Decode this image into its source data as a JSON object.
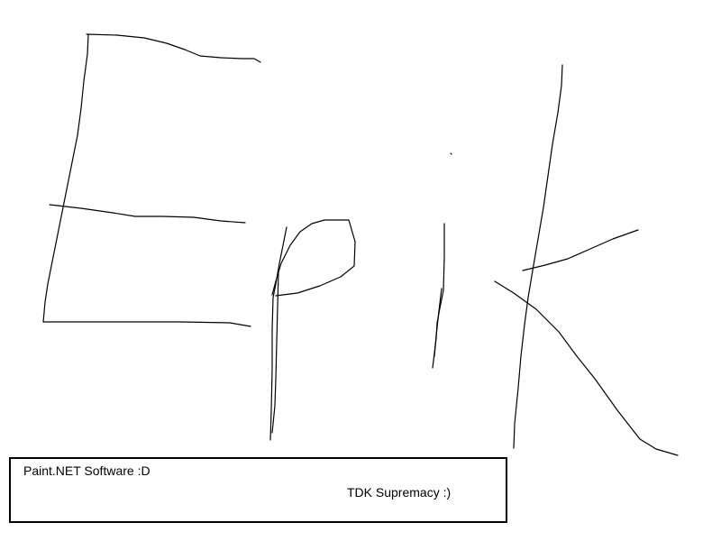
{
  "canvas": {
    "background": "#ffffff",
    "stroke_color": "#000000",
    "drawn_word": "Epik"
  },
  "caption": {
    "line1": "Paint.NET Software :D",
    "line2": "TDK Supremacy :)"
  }
}
